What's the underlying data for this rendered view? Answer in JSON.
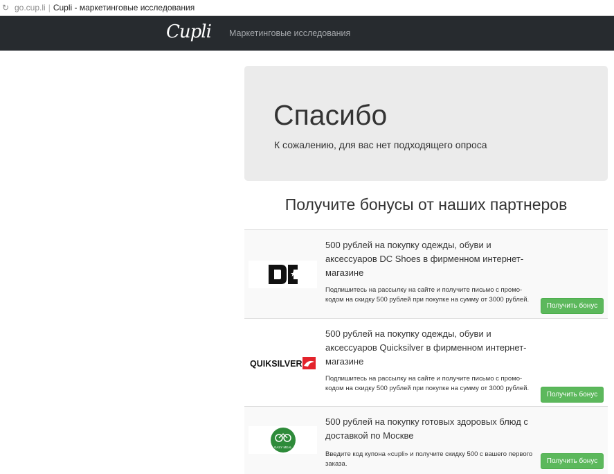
{
  "browser": {
    "domain": "go.cup.li",
    "separator": "|",
    "title": "Cupli - маркетинговые исследования"
  },
  "navbar": {
    "logo": "Cupli",
    "link": "Маркетинговые исследования"
  },
  "jumbotron": {
    "heading": "Спасибо",
    "text": "К сожалению, для вас нет подходящего опроса"
  },
  "partners": {
    "title": "Получите бонусы от наших партнеров",
    "offers": [
      {
        "logo": "DC Shoes",
        "title": "500 рублей на покупку одежды, обуви и аксессуаров DC Shoes в фирменном интернет-магазине",
        "description": "Подпишитесь на рассылку на сайте и получите письмо с промо-кодом на скидку 500 рублей при покупке на сумму от 3000 рублей.",
        "button": "Получить бонус"
      },
      {
        "logo": "QUIKSILVER",
        "title": "500 рублей на покупку одежды, обуви и аксессуаров Quicksilver в фирменном интернет-магазине",
        "description": "Подпишитесь на рассылку на сайте и получите письмо с промо-кодом на скидку 500 рублей при покупке на сумму от 3000 рублей.",
        "button": "Получить бонус"
      },
      {
        "logo": "EASY MEAL",
        "title": "500 рублей на покупку готовых здоровых блюд с доставкой по Москве",
        "description": "Введите код купона «cupli» и получите скидку 500 с вашего первого заказа.",
        "button": "Получить бонус"
      }
    ]
  },
  "colors": {
    "navbar": "#272b2f",
    "jumbotron": "#ebebeb",
    "button": "#5cb85c",
    "quiksilver_red": "#e3232b",
    "easymeal_green": "#2e8b3a"
  }
}
